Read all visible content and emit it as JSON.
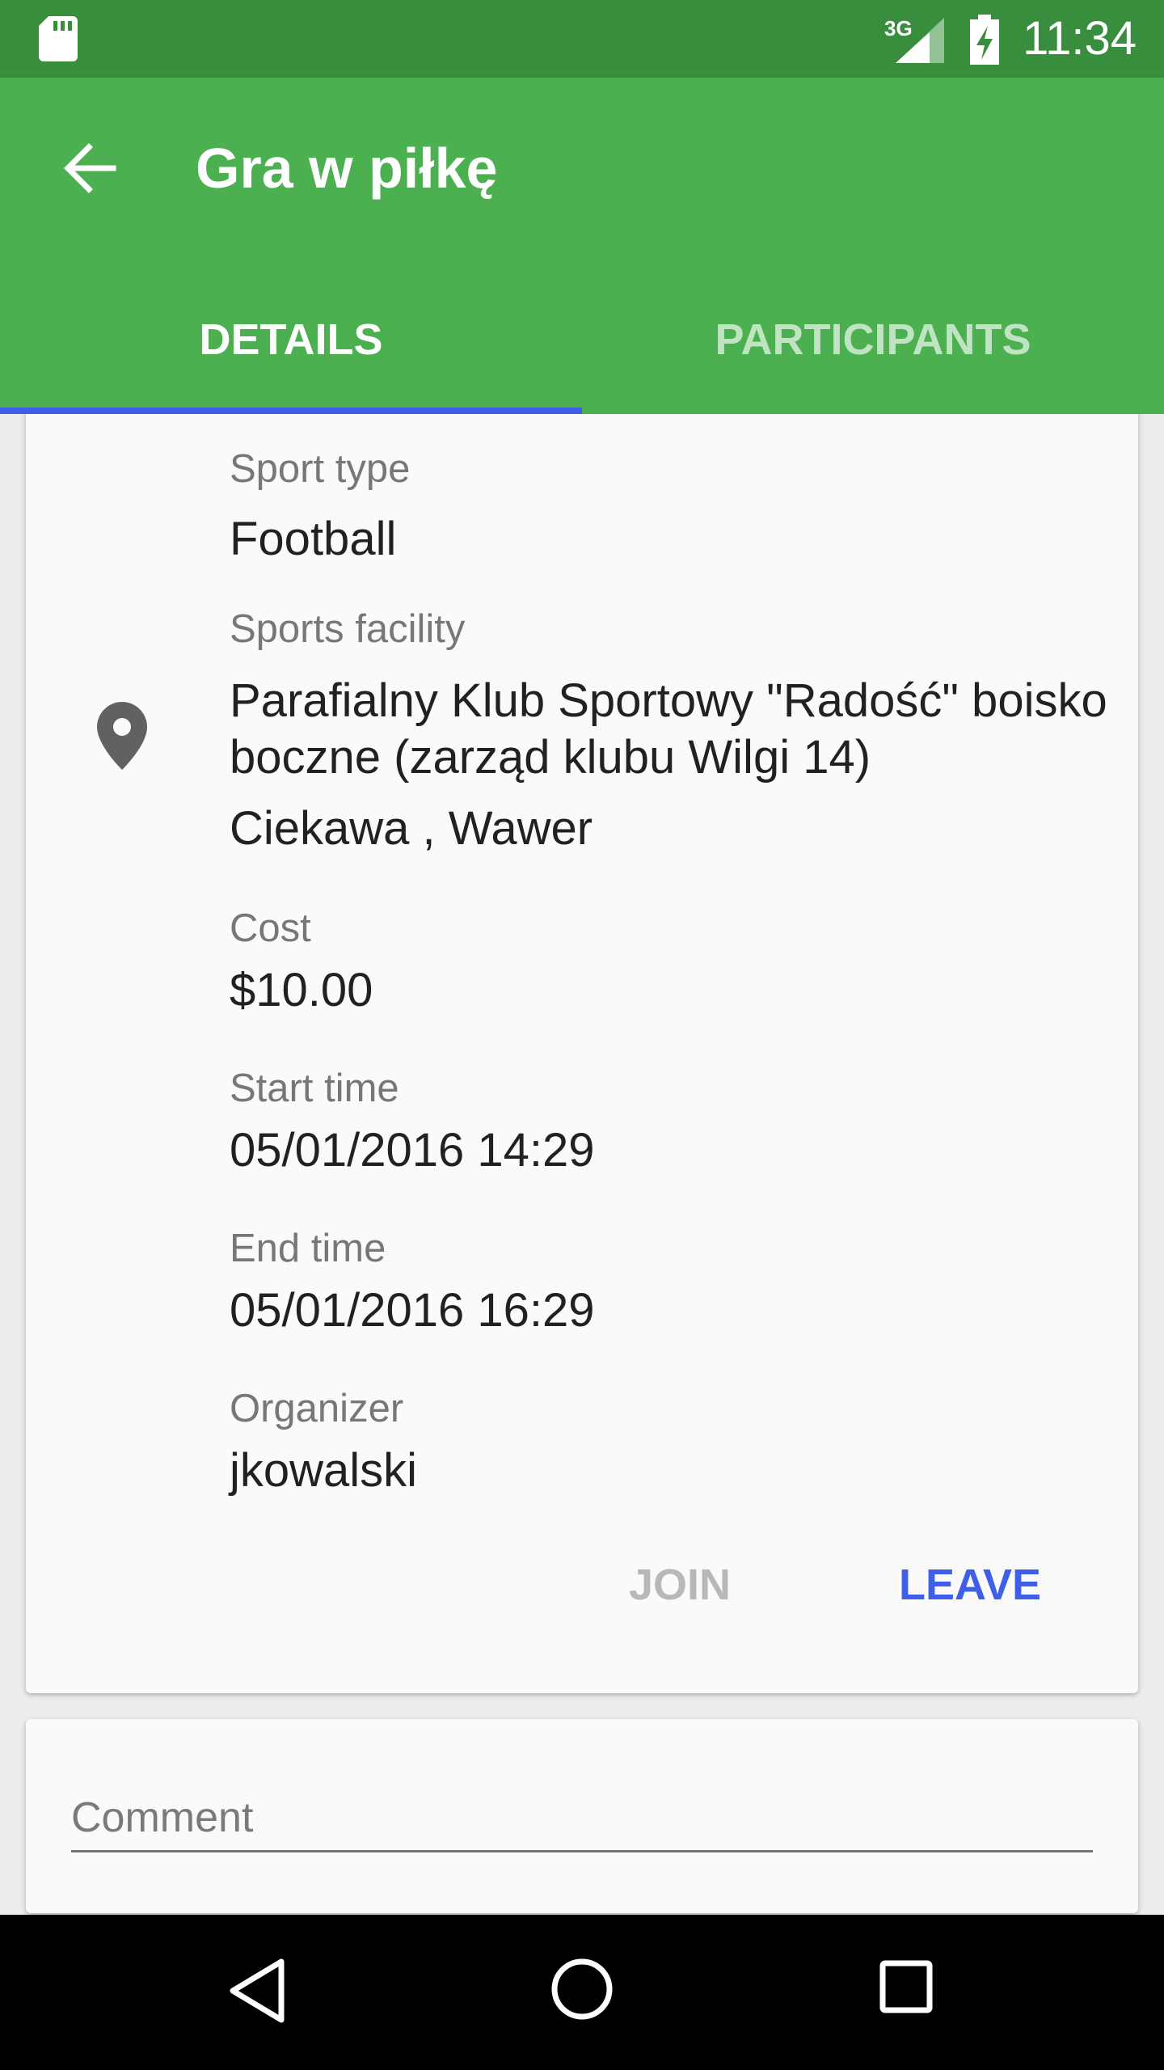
{
  "status_bar": {
    "network": "3G",
    "time": "11:34",
    "icons": [
      "sd-card-icon",
      "signal-icon",
      "battery-charging-icon"
    ]
  },
  "app_bar": {
    "title": "Gra w piłkę",
    "back_icon": "arrow-back-icon",
    "color": "#4caf50"
  },
  "tabs": [
    {
      "label": "DETAILS",
      "selected": true
    },
    {
      "label": "PARTICIPANTS",
      "selected": false
    }
  ],
  "details": {
    "sport_type_label": "Sport type",
    "sport_type_value": "Football",
    "facility_label": "Sports facility",
    "facility_name_line1": "Parafialny Klub Sportowy \"Radość\" boisko",
    "facility_name_line2": "boczne (zarząd klubu Wilgi 14)",
    "facility_address": "Ciekawa , Wawer",
    "cost_label": "Cost",
    "cost_value": "$10.00",
    "start_label": "Start time",
    "start_value": "05/01/2016 14:29",
    "end_label": "End time",
    "end_value": "05/01/2016 16:29",
    "organizer_label": "Organizer",
    "organizer_value": "jkowalski",
    "location_icon": "map-pin-icon"
  },
  "actions": {
    "join_label": "JOIN",
    "join_enabled": false,
    "leave_label": "LEAVE",
    "accent_color": "#3f5fe8"
  },
  "comment": {
    "placeholder": "Comment",
    "value": ""
  },
  "nav_bar": {
    "buttons": [
      "back-triangle-icon",
      "home-circle-icon",
      "recents-square-icon"
    ]
  }
}
